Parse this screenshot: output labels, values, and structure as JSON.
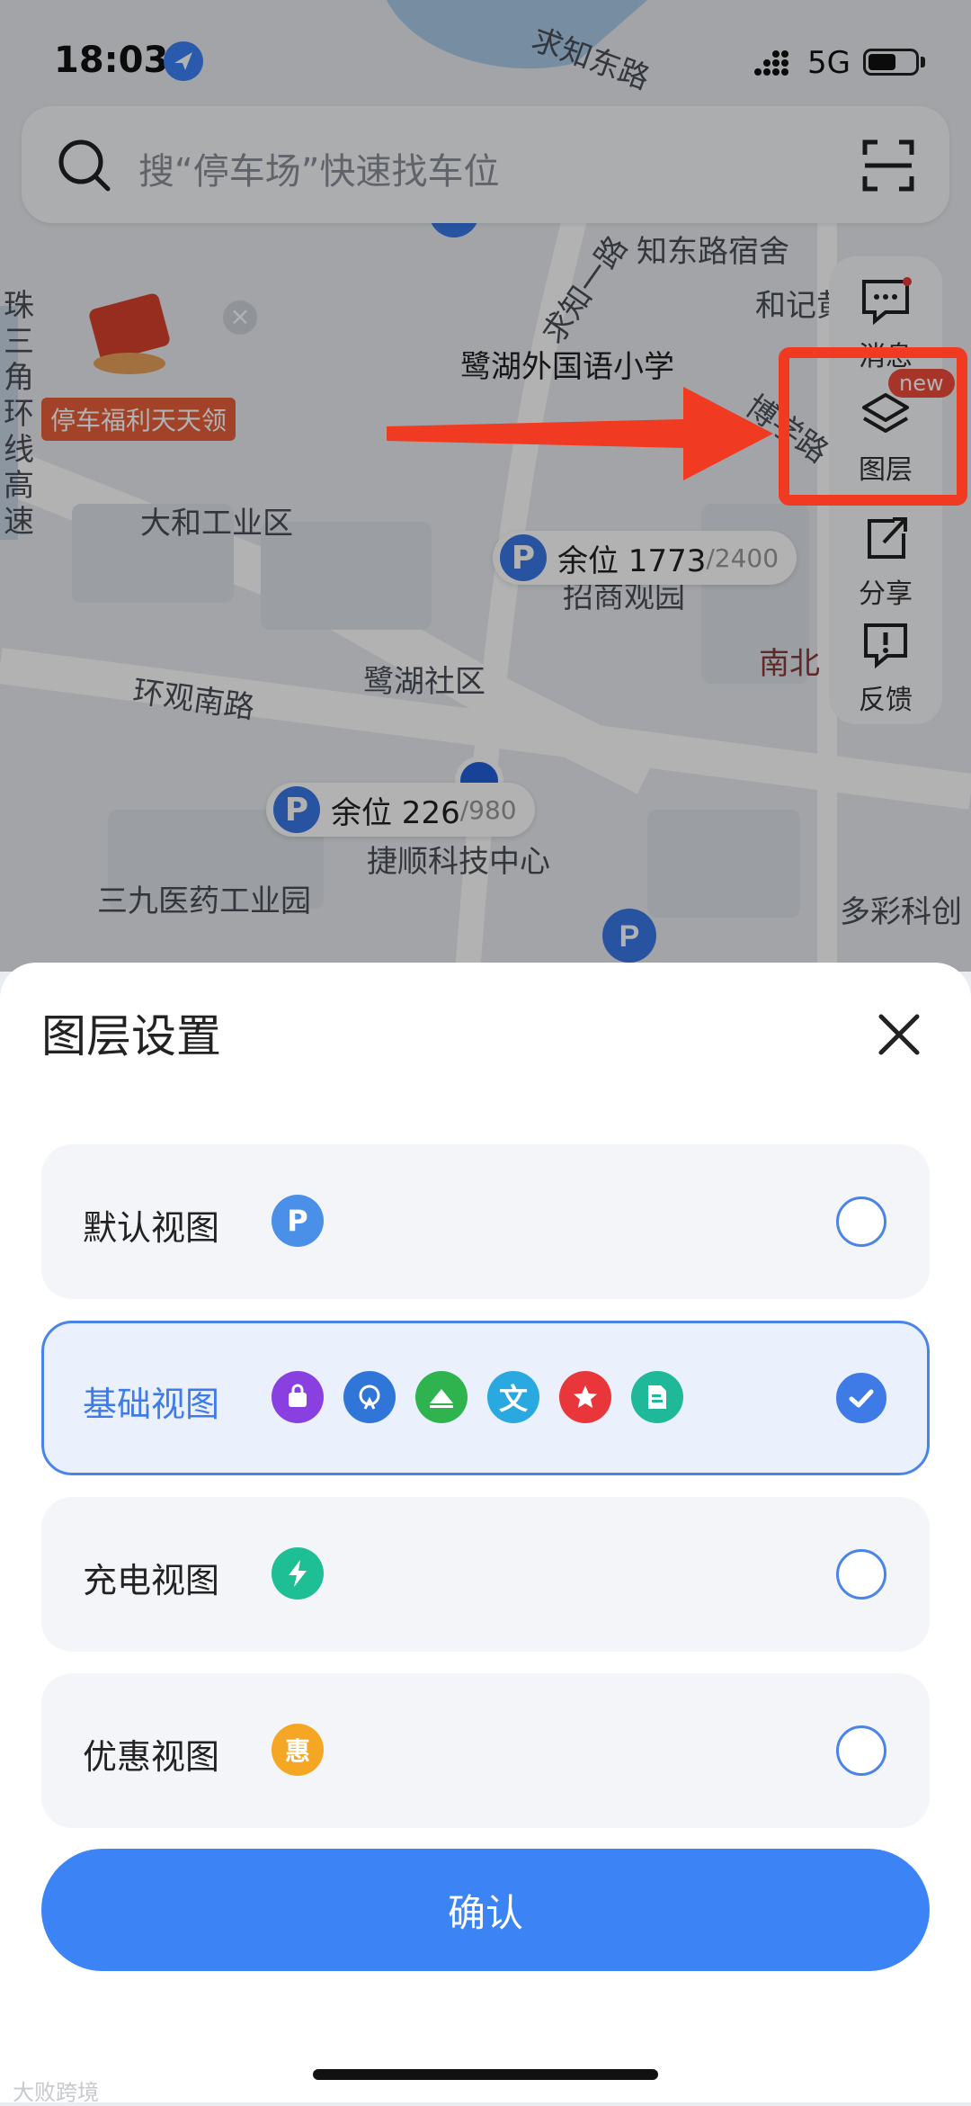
{
  "status_bar": {
    "time": "18:03",
    "network": "5G"
  },
  "search": {
    "placeholder": "搜“停车场”快速找车位"
  },
  "side_toolbar": {
    "items": [
      {
        "label": "消息",
        "icon": "message-icon"
      },
      {
        "label": "图层",
        "icon": "layers-icon",
        "badge": "new"
      },
      {
        "label": "分享",
        "icon": "share-icon"
      },
      {
        "label": "反馈",
        "icon": "feedback-icon"
      }
    ]
  },
  "map": {
    "promo": "停车福利天天领",
    "labels": [
      "求知东路",
      "知东路宿舍",
      "和记黄",
      "求知一路",
      "鹭湖外国语小学",
      "博学路",
      "大和工业区",
      "招商观园",
      "南北",
      "环观南路",
      "鹭湖社区",
      "捷顺科技中心",
      "三九医药工业园",
      "多彩科创",
      "珠三角环线高速"
    ],
    "parking": [
      {
        "available_label": "余位 1773",
        "total": "/2400"
      },
      {
        "available_label": "余位 226",
        "total": "/980"
      }
    ]
  },
  "sheet": {
    "title": "图层设置",
    "options": [
      {
        "name": "默认视图",
        "selected": false
      },
      {
        "name": "基础视图",
        "selected": true
      },
      {
        "name": "充电视图",
        "selected": false
      },
      {
        "name": "优惠视图",
        "selected": false
      }
    ],
    "default_icon": "P",
    "basic_icon_text": "文",
    "promo_icon": "惠",
    "confirm_label": "确认"
  },
  "watermark": "大败跨境",
  "colors": {
    "accent": "#3c84f6",
    "highlight_red": "#f03a22"
  }
}
